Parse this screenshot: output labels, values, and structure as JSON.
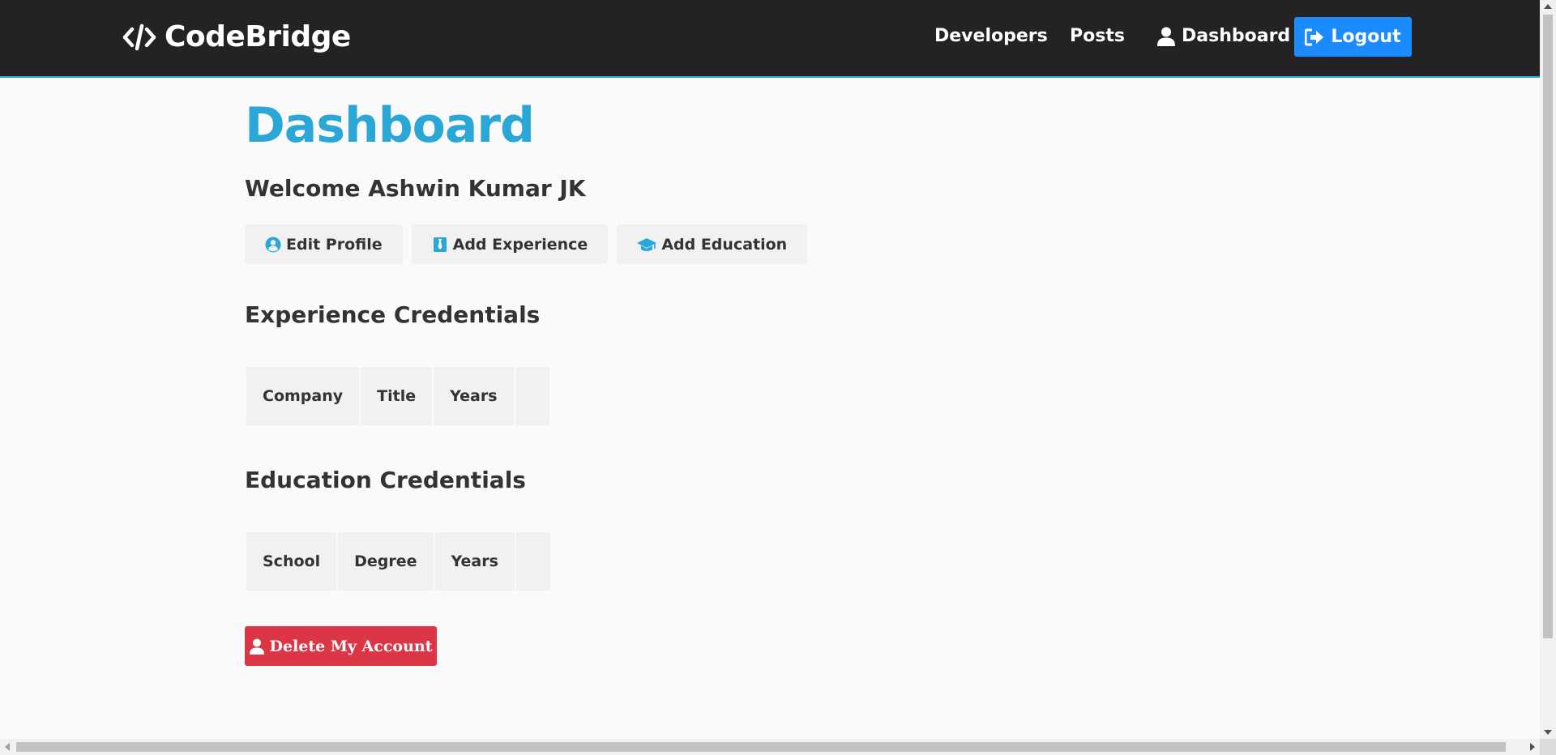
{
  "navbar": {
    "brand": "CodeBridge",
    "brand_icon": "code-icon",
    "links": [
      {
        "label": "Developers"
      },
      {
        "label": "Posts"
      },
      {
        "label": "Dashboard",
        "icon": "user-icon"
      }
    ],
    "logout": {
      "label": "Logout",
      "icon": "sign-out-icon",
      "color": "#1a8cff"
    }
  },
  "main": {
    "title": "Dashboard",
    "title_color": "#2aa7d6",
    "welcome": "Welcome Ashwin Kumar JK",
    "actions": [
      {
        "label": "Edit Profile",
        "icon": "user-circle-icon"
      },
      {
        "label": "Add Experience",
        "icon": "briefcase-icon"
      },
      {
        "label": "Add Education",
        "icon": "graduation-cap-icon"
      }
    ],
    "experience": {
      "title": "Experience Credentials",
      "columns": [
        "Company",
        "Title",
        "Years",
        ""
      ]
    },
    "education": {
      "title": "Education Credentials",
      "columns": [
        "School",
        "Degree",
        "Years",
        ""
      ]
    },
    "delete": {
      "label": "Delete My Account",
      "icon": "user-icon",
      "color": "#dc3545"
    }
  }
}
